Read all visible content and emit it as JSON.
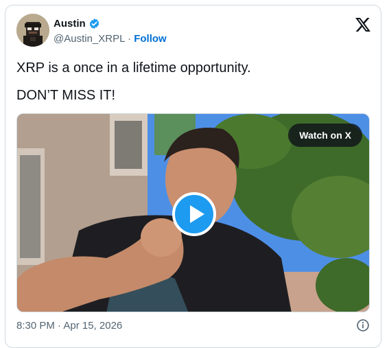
{
  "author": {
    "name": "Austin",
    "handle": "@Austin_XRPL",
    "separator": "·",
    "follow_label": "Follow"
  },
  "tweet": {
    "lines": [
      "XRP is a once in a lifetime opportunity.",
      "DON’T MISS IT!"
    ]
  },
  "video": {
    "watch_label": "Watch on X"
  },
  "footer": {
    "timestamp": "8:30 PM · Apr 15, 2026"
  },
  "icons": {
    "verified": "verified-badge-icon",
    "logo": "x-logo-icon",
    "play": "play-icon",
    "info": "info-icon"
  },
  "colors": {
    "accent": "#1d9bf0",
    "follow": "#006fd6",
    "text": "#0f1419",
    "muted": "#536471"
  }
}
